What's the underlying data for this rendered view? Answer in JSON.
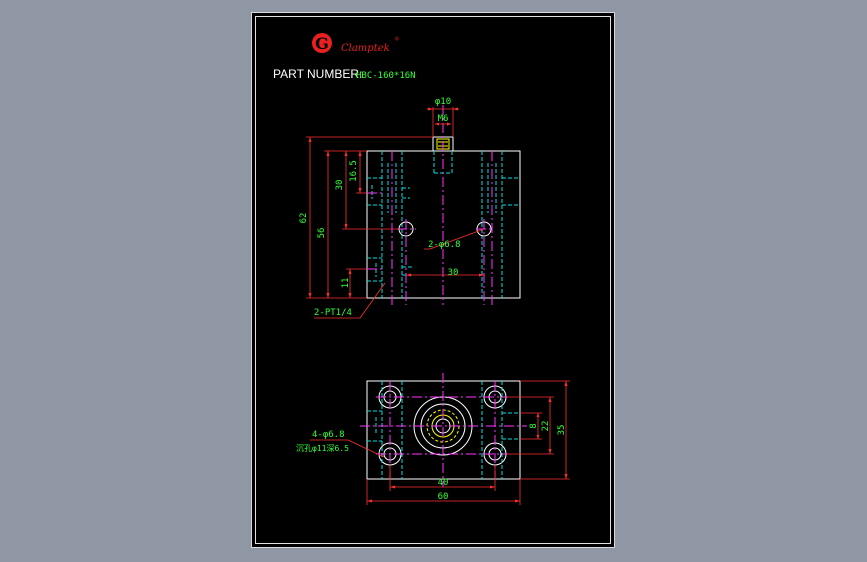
{
  "colors": {
    "background": "#8e97a3",
    "sheet": "#000000",
    "outline": "#ffffff",
    "hidden": "#00e0e0",
    "center": "#ff33ff",
    "dimension": "#ff3030",
    "dim_text": "#33ff33",
    "logo": "#e82020",
    "yellow": "#ffff00"
  },
  "header": {
    "logo_mark": "G",
    "logo_name": "Clamptek",
    "registered": "®",
    "part_label": "PART NUMBER:",
    "part_value": "HBC-160*16N"
  },
  "front_view": {
    "dim_phi10": "φ10",
    "dim_m6": "M6",
    "dim_62": "62",
    "dim_56": "56",
    "dim_30": "30",
    "dim_16_5": "16.5",
    "dim_11": "11",
    "dim_holes": "2-φ6.8",
    "dim_30_h": "30",
    "dim_port": "2-PT1/4"
  },
  "bottom_view": {
    "dim_40": "40",
    "dim_60": "60",
    "dim_35": "35",
    "dim_22": "22",
    "dim_8": "8",
    "dim_holes": "4-φ6.8",
    "dim_cbore": "沉孔φ11深6.5"
  }
}
